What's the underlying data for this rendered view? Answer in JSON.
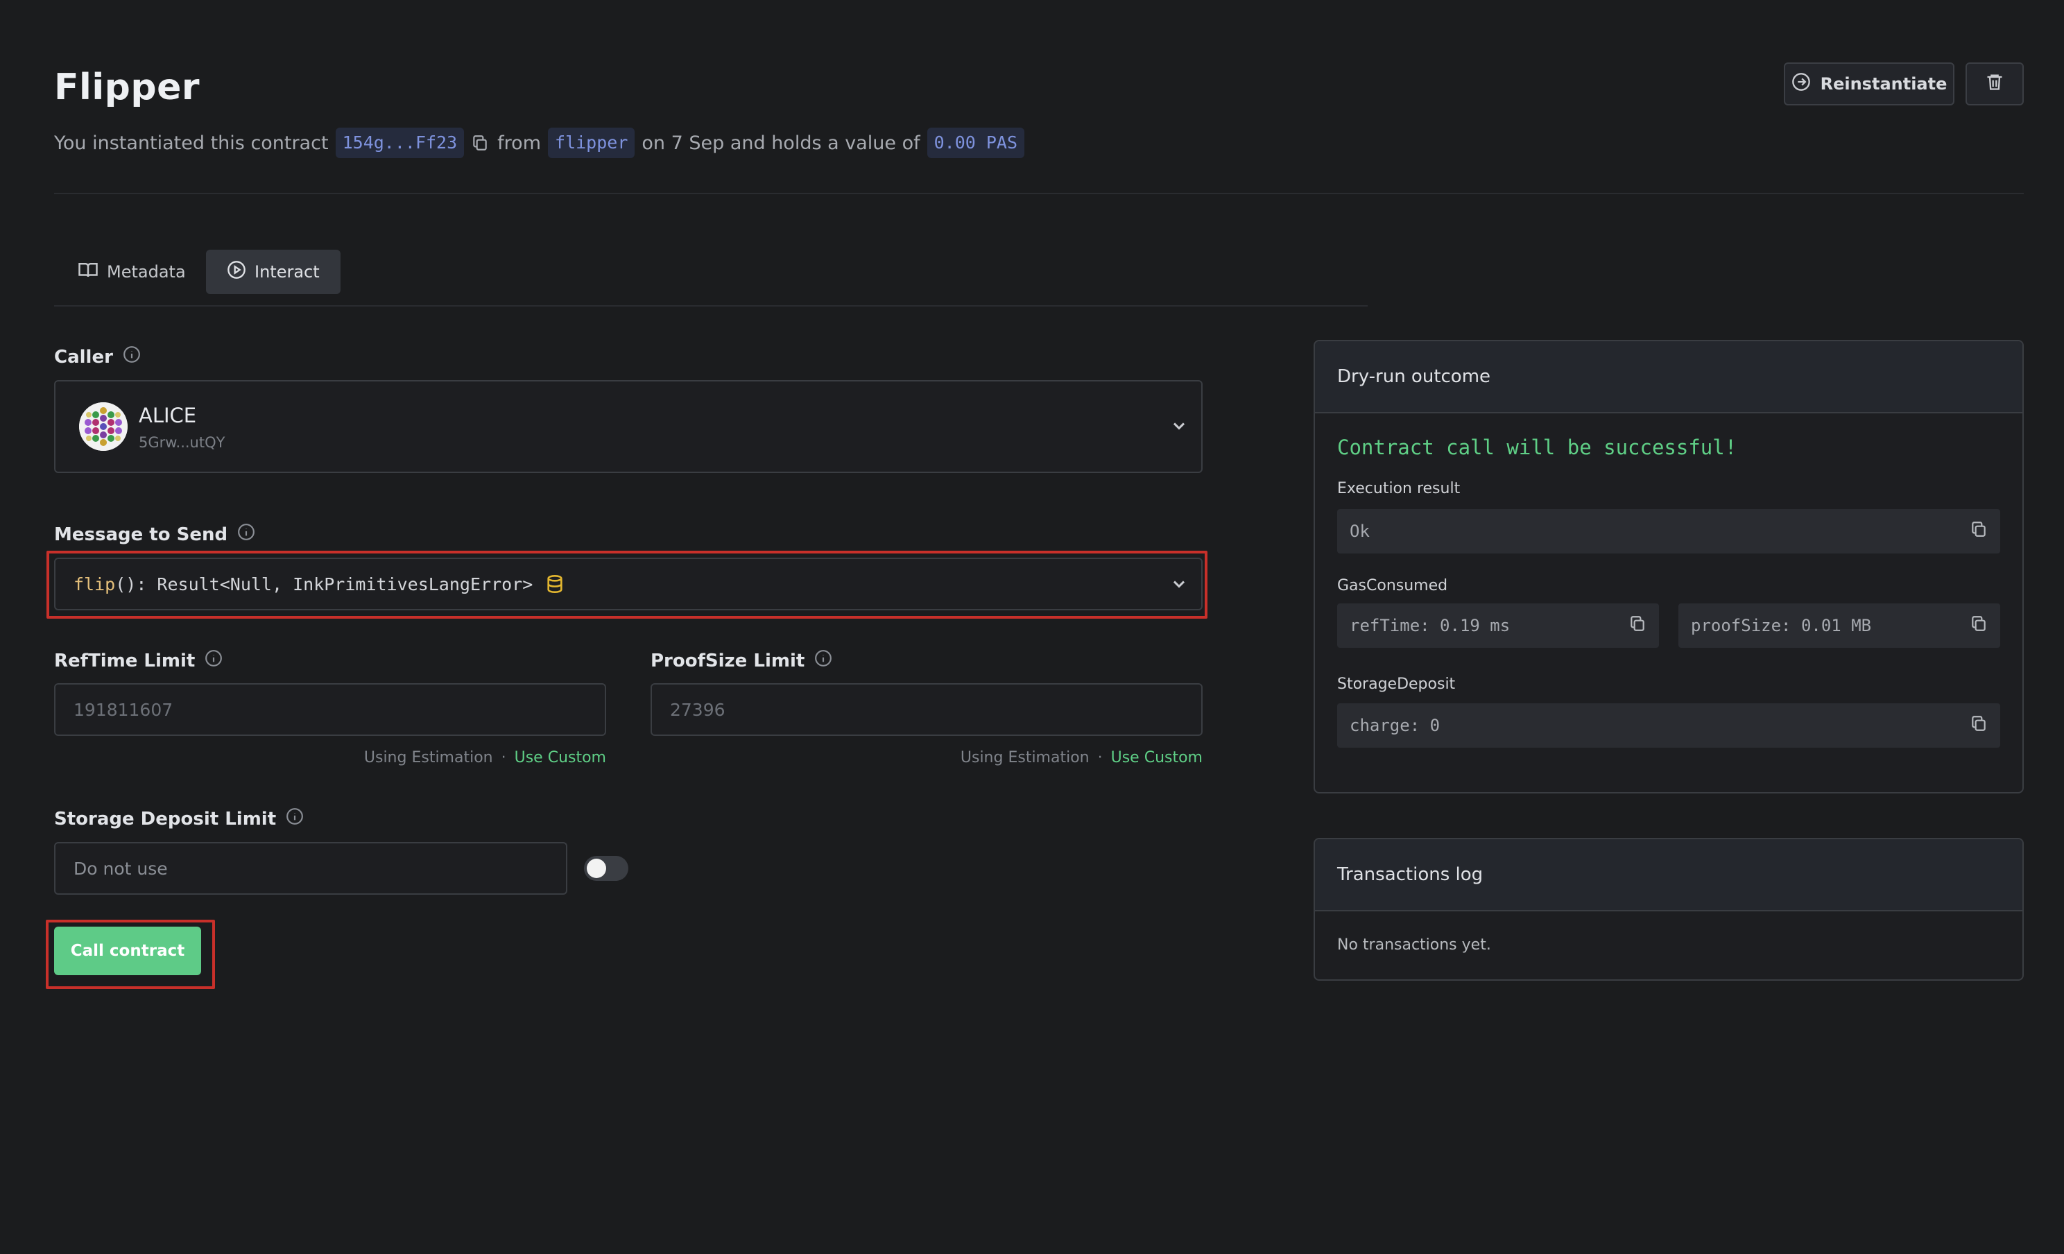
{
  "header": {
    "title": "Flipper",
    "sub_prefix": "You instantiated this contract",
    "address": "154g...Ff23",
    "sub_from": "from",
    "code_name": "flipper",
    "sub_mid": "on 7 Sep and holds a value of",
    "value": "0.00 PAS",
    "reinstantiate_label": "Reinstantiate"
  },
  "tabs": [
    {
      "label": "Metadata"
    },
    {
      "label": "Interact",
      "active": true
    }
  ],
  "caller": {
    "label": "Caller",
    "name": "ALICE",
    "address": "5Grw...utQY"
  },
  "message": {
    "label": "Message to Send",
    "fn_name": "flip",
    "signature": "(): Result<Null, InkPrimitivesLangError>"
  },
  "reftime": {
    "label": "RefTime Limit",
    "placeholder": "191811607",
    "estimation": "Using Estimation",
    "sep": "·",
    "custom": "Use Custom"
  },
  "proofsize": {
    "label": "ProofSize Limit",
    "placeholder": "27396",
    "estimation": "Using Estimation",
    "sep": "·",
    "custom": "Use Custom"
  },
  "storage": {
    "label": "Storage Deposit Limit",
    "placeholder": "Do not use",
    "toggle_on": false
  },
  "call_button": "Call contract",
  "dry_run": {
    "title": "Dry-run outcome",
    "status": "Contract call will be successful!",
    "execution_label": "Execution result",
    "execution_value": "Ok",
    "gas_label": "GasConsumed",
    "reftime_value": "refTime: 0.19 ms",
    "proofsize_value": "proofSize: 0.01 MB",
    "storage_label": "StorageDeposit",
    "storage_value": "charge: 0"
  },
  "tx_log": {
    "title": "Transactions log",
    "empty": "No transactions yet."
  },
  "colors": {
    "background": "#1b1c1e",
    "accent_green": "#5ecb87",
    "chip_text": "#7e92dd",
    "highlight_red": "#c8302a",
    "fn_name": "#e5c07b"
  }
}
